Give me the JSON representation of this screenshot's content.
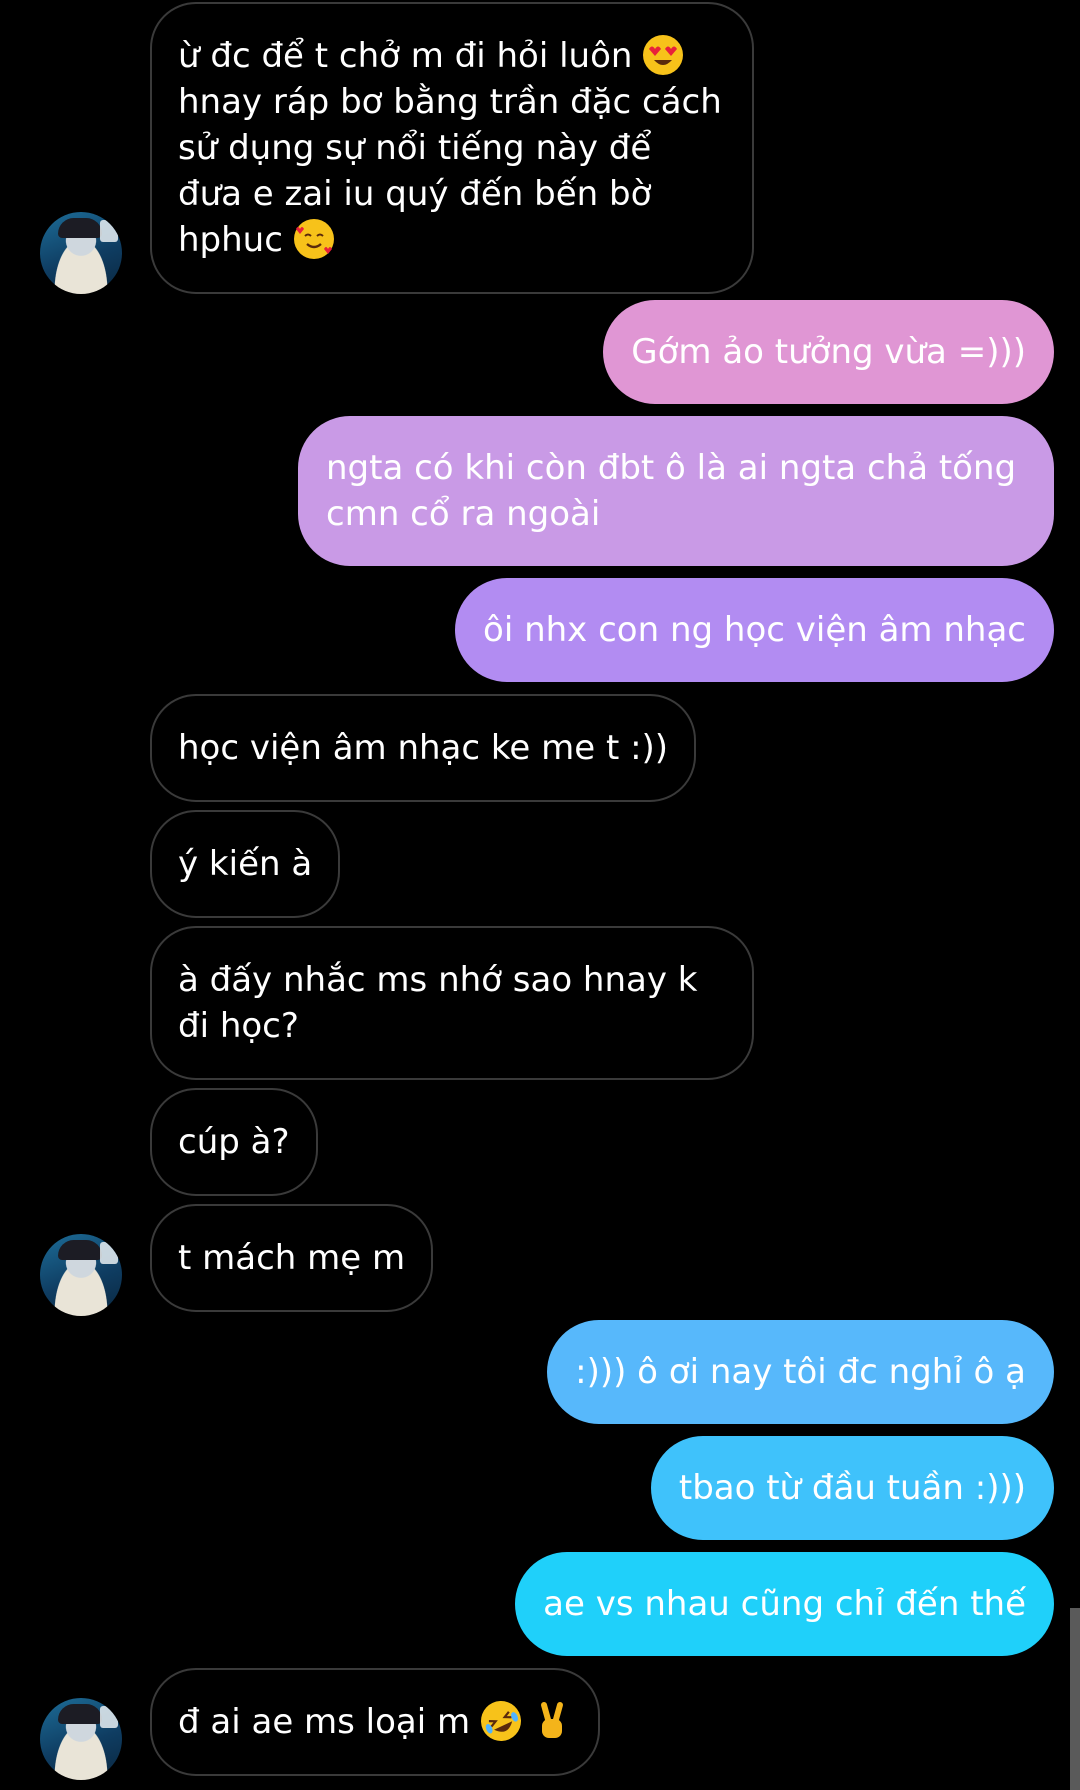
{
  "conversation": {
    "messages": [
      {
        "side": "in",
        "text_1": "ừ đc để t chở m đi hỏi luôn",
        "emoji_1": "heart-eyes-emoji",
        "text_2": "hnay ráp bơ bằng trần đặc cách sử dụng sự nổi tiếng này để đưa e zai iu quý đến bến bờ hphuc",
        "emoji_2": "smiling-face-with-hearts-emoji"
      },
      {
        "side": "out",
        "text": "Gớm ảo tưởng vừa =)))",
        "color": "#e096d4"
      },
      {
        "side": "out",
        "text": "ngta có khi còn đbt ô là ai ngta chả tống cmn cổ ra ngoài",
        "color": "#c99ae6"
      },
      {
        "side": "out",
        "text": "ôi nhx con ng học viện âm nhạc",
        "color": "#b28cf2"
      },
      {
        "side": "in",
        "text": "học viện âm nhạc ke me t :))"
      },
      {
        "side": "in",
        "text": "ý kiến à"
      },
      {
        "side": "in",
        "text": "à đấy nhắc ms nhớ sao hnay k đi học?"
      },
      {
        "side": "in",
        "text": "cúp à?"
      },
      {
        "side": "in",
        "text": "t mách mẹ m"
      },
      {
        "side": "out",
        "text": ":))) ô ơi nay tôi đc nghỉ ô ạ",
        "color": "#57b8fb"
      },
      {
        "side": "out",
        "text": "tbao từ đầu tuần :)))",
        "color": "#3fc2fb"
      },
      {
        "side": "out",
        "text": "ae vs nhau cũng chỉ đến thế",
        "color": "#1fd0fa"
      },
      {
        "side": "in",
        "text": "đ ai ae ms loại m",
        "emoji_1": "rolling-on-floor-laughing-emoji",
        "emoji_2": "victory-hand-emoji"
      }
    ]
  },
  "colors": {
    "background": "#000000",
    "incoming_border": "#3a3a3a",
    "text": "#ffffff"
  }
}
